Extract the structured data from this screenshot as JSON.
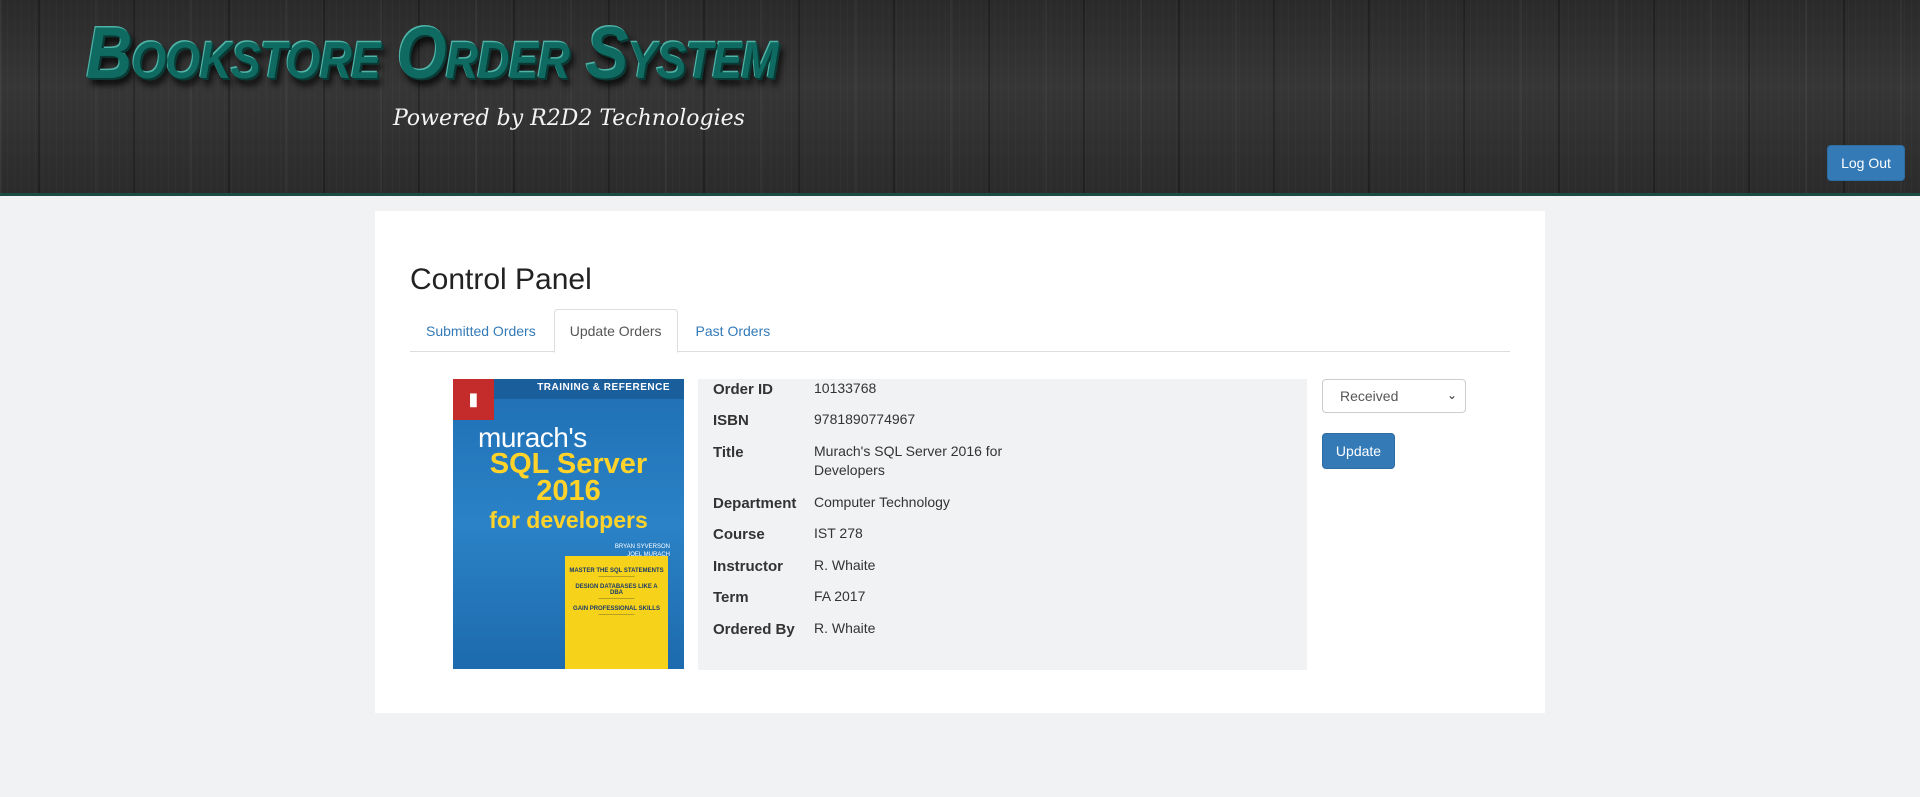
{
  "header": {
    "title": "Bookstore Order System",
    "subtitle": "Powered by R2D2 Technologies",
    "logout_label": "Log Out"
  },
  "page": {
    "title": "Control Panel",
    "tabs": [
      {
        "label": "Submitted Orders",
        "active": false
      },
      {
        "label": "Update Orders",
        "active": true
      },
      {
        "label": "Past Orders",
        "active": false
      }
    ]
  },
  "cover": {
    "top_text": "TRAINING & REFERENCE",
    "brand": "murach's",
    "title_line1": "SQL Server",
    "title_line2": "2016",
    "title_line3": "for developers",
    "authors": [
      "BRYAN SYVERSON",
      "JOEL MURACH"
    ],
    "box_headings": [
      "MASTER THE SQL STATEMENTS",
      "DESIGN DATABASES LIKE A DBA",
      "GAIN PROFESSIONAL SKILLS"
    ],
    "logo_text": "MURACH"
  },
  "order": {
    "fields": [
      {
        "label": "Order ID",
        "value": "10133768"
      },
      {
        "label": "ISBN",
        "value": "9781890774967"
      },
      {
        "label": "Title",
        "value": "Murach's SQL Server 2016 for Developers"
      },
      {
        "label": "Department",
        "value": "Computer Technology"
      },
      {
        "label": "Course",
        "value": "IST 278"
      },
      {
        "label": "Instructor",
        "value": "R. Whaite"
      },
      {
        "label": "Term",
        "value": "FA 2017"
      },
      {
        "label": "Ordered By",
        "value": "R. Whaite"
      }
    ]
  },
  "status": {
    "selected": "Received",
    "update_label": "Update"
  },
  "colors": {
    "primary": "#337ab7",
    "brand": "#0f6b62"
  }
}
